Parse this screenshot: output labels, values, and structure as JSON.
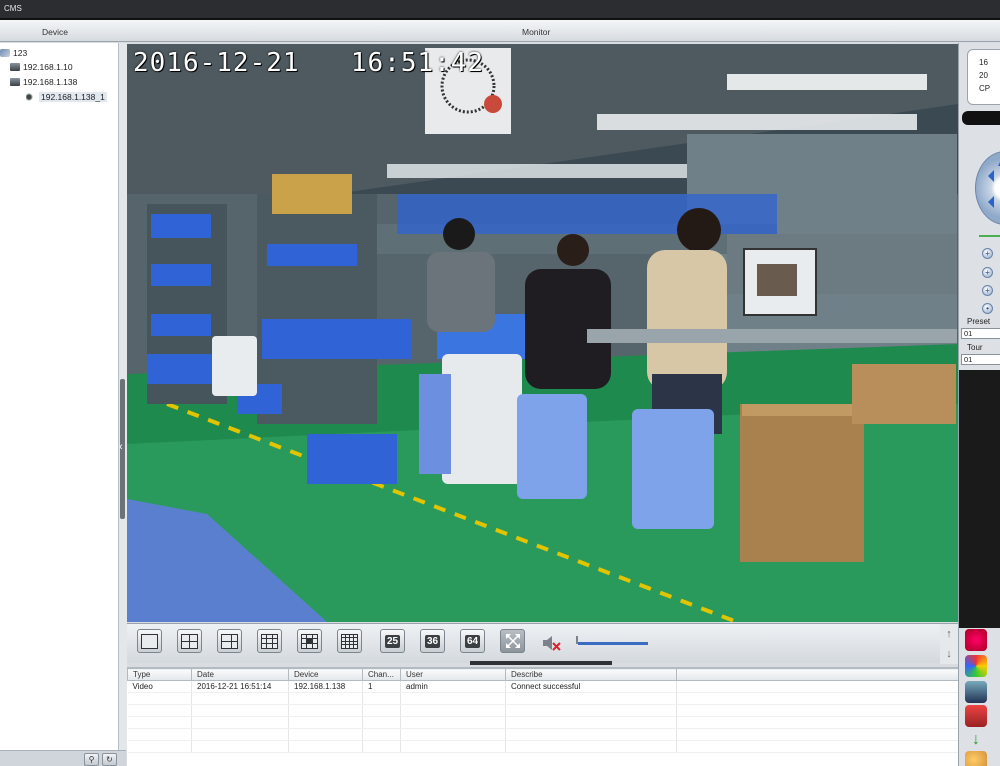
{
  "window": {
    "title": "CMS"
  },
  "header": {
    "device_label": "Device",
    "monitor_label": "Monitor"
  },
  "device_tree": {
    "items": [
      {
        "label": "123",
        "level": 0,
        "icon": "group-icon"
      },
      {
        "label": "192.168.1.10",
        "level": 1,
        "icon": "dvr-icon"
      },
      {
        "label": "192.168.1.138",
        "level": 1,
        "icon": "dvr-icon"
      },
      {
        "label": "192.168.1.138_1",
        "level": 2,
        "icon": "camera-icon",
        "selected": true
      }
    ]
  },
  "video": {
    "osd_date": "2016-12-21",
    "osd_time": "16:51:42"
  },
  "toolbar": {
    "layouts": [
      {
        "name": "layout-1",
        "kind": "grid",
        "cells": 1
      },
      {
        "name": "layout-4",
        "kind": "grid",
        "cells": 4
      },
      {
        "name": "layout-6",
        "kind": "grid",
        "cells": 6
      },
      {
        "name": "layout-9",
        "kind": "grid",
        "cells": 9
      },
      {
        "name": "layout-13",
        "kind": "grid",
        "cells": 13
      },
      {
        "name": "layout-16",
        "kind": "grid",
        "cells": 16
      },
      {
        "name": "layout-25",
        "kind": "number",
        "label": "25"
      },
      {
        "name": "layout-36",
        "kind": "number",
        "label": "36"
      },
      {
        "name": "layout-64",
        "kind": "number",
        "label": "64"
      }
    ],
    "volume_level": 0.0
  },
  "log": {
    "columns": [
      "Type",
      "Date",
      "Device",
      "Chan...",
      "User",
      "Describe",
      ""
    ],
    "rows": [
      [
        "Video",
        "2016-12-21 16:51:14",
        "192.168.1.138",
        "1",
        "admin",
        "Connect successful",
        ""
      ]
    ]
  },
  "right_panel": {
    "clock_line1": "16",
    "clock_line2": "20",
    "clock_line3": "CP",
    "preset_label": "Preset",
    "preset_value": "01",
    "tour_label": "Tour",
    "tour_value": "01"
  },
  "colors": {
    "accent": "#3b6cc4",
    "title_bar": "#2b2d30",
    "floor": "#1f8a4e",
    "crate_blue": "#2f63d6"
  }
}
